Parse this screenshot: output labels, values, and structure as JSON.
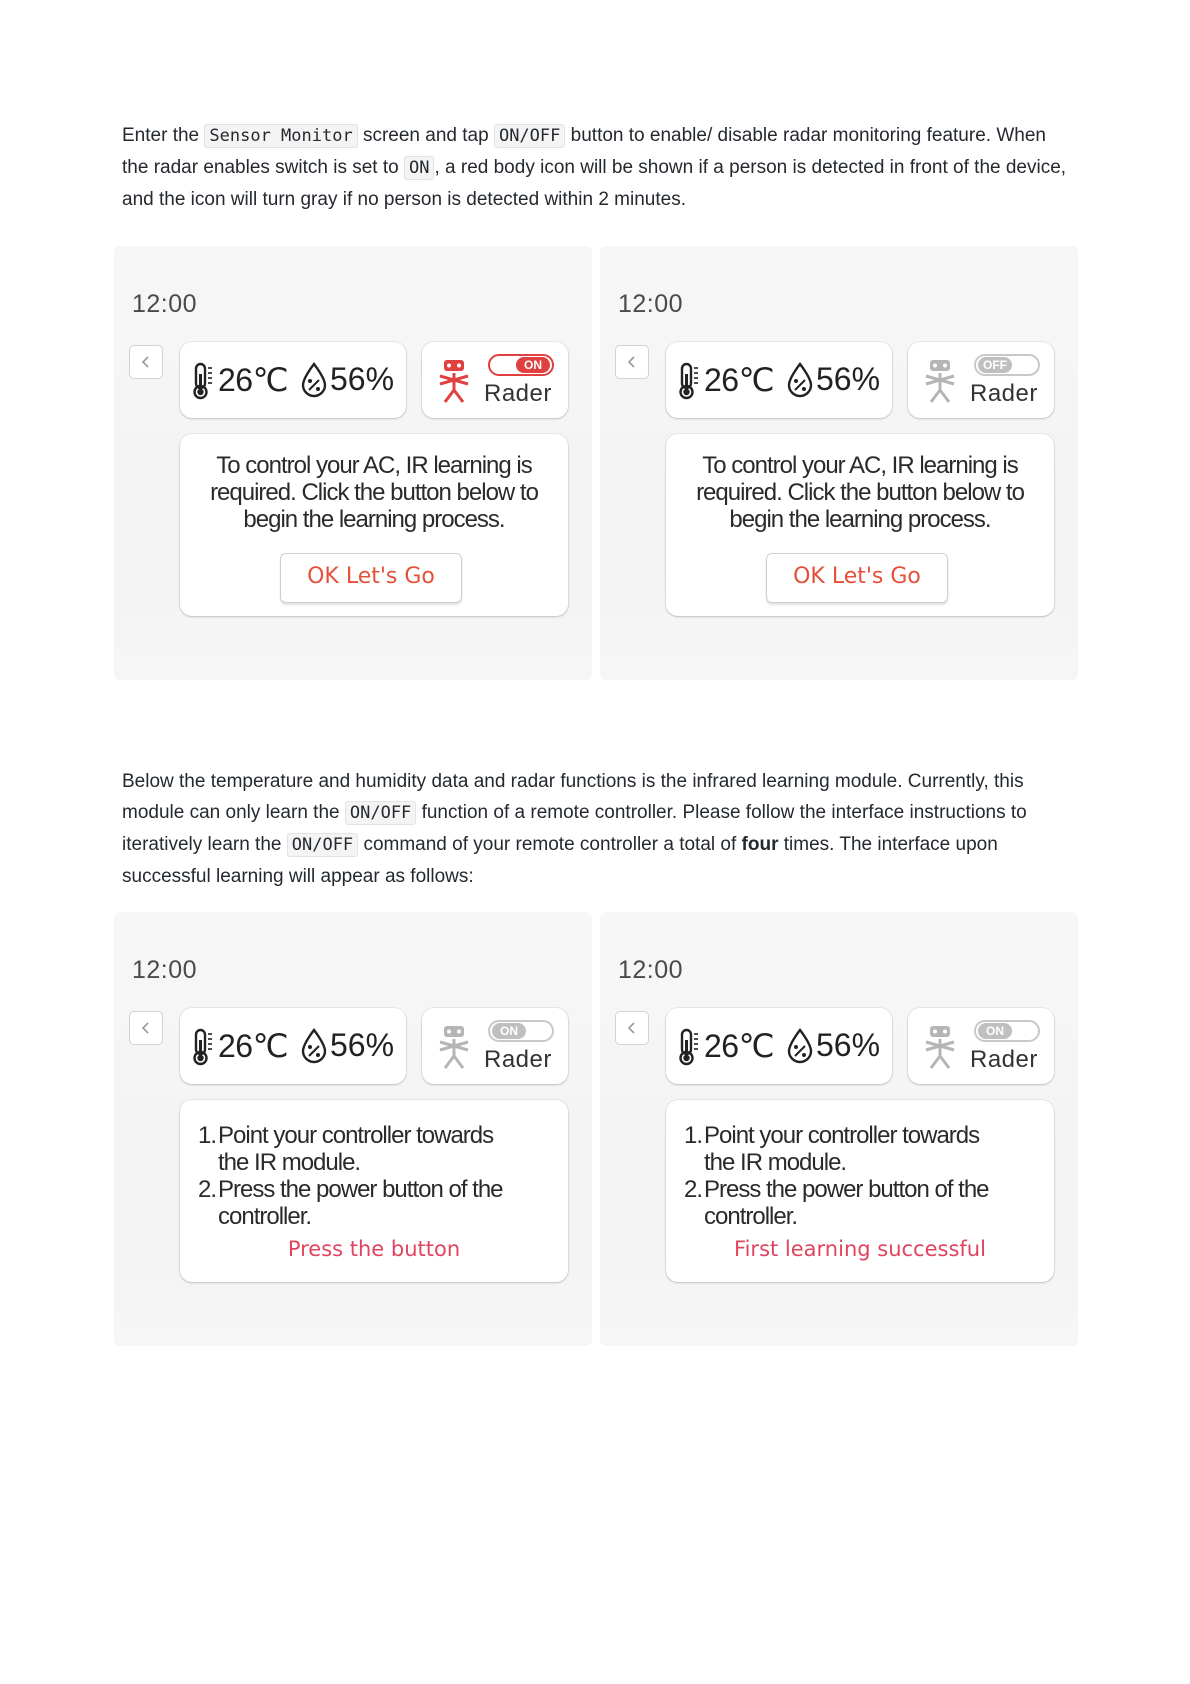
{
  "intro": {
    "enter": "Enter the",
    "sensor_monitor": "Sensor Monitor",
    "screen_tap": "screen and tap",
    "on_off": "ON/OFF",
    "button_to": "button to enable/ disable radar monitoring feature. When the radar enables switch is set to",
    "on": "ON",
    "rest": ", a red body icon will be shown if a person is detected in front of the device, and the icon will turn gray if no person is detected within 2 minutes."
  },
  "learning": {
    "p1": "Below the temperature and humidity data and radar functions is the infrared learning module. Currently, this module can only learn the",
    "on_off": "ON/OFF",
    "p2": "function of a remote controller. Please follow the interface instructions to iteratively learn the",
    "on_off_2": "ON/OFF",
    "p3": "command of your remote controller a total of",
    "four": "four",
    "p4": "times. The interface upon successful learning will appear as follows:"
  },
  "screens": {
    "time": "12:00",
    "temperature": "26℃",
    "humidity": "56%",
    "radar_label": "Rader",
    "toggle_on": "ON",
    "toggle_off": "OFF",
    "ir_prompt": "To control your AC, IR learning is required. Click the button below to begin the learning process.",
    "ok_button": "OK Let's Go",
    "step1_num": "1.",
    "step1_a": "Point your controller towards",
    "step1_b": "the IR module.",
    "step2_num": "2.",
    "step2_a": "Press the power button of the",
    "step2_b": "controller.",
    "press_status": "Press the button",
    "success_status": "First learning successful"
  },
  "colors": {
    "accent_red": "#e0403f",
    "status_pink": "#e0445e",
    "inactive_gray": "#bfbfbf"
  }
}
